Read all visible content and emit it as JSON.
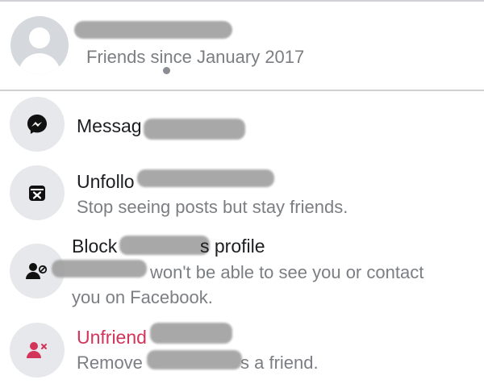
{
  "header": {
    "friends_since": "Friends since January 2017"
  },
  "menu": {
    "message": {
      "label": "Messag"
    },
    "unfollow": {
      "label": "Unfollo",
      "sub": "Stop seeing posts but stay friends."
    },
    "block": {
      "label_start": "Block",
      "label_end": "s profile",
      "sub_line1": "won't be able to see you or contact",
      "sub_line2": "you on Facebook."
    },
    "unfriend": {
      "label": "Unfriend",
      "sub_start": "Remove",
      "sub_end": "s a friend."
    }
  },
  "colors": {
    "danger": "#d2345a",
    "muted": "#7b7e82",
    "icon_bg": "#e6e8eb"
  },
  "icons": [
    "messenger-icon",
    "unfollow-icon",
    "block-icon",
    "unfriend-icon"
  ]
}
